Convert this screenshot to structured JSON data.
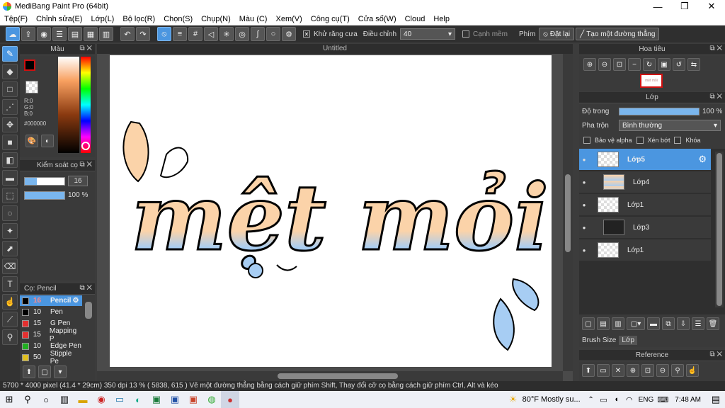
{
  "app": {
    "title": "MediBang Paint Pro (64bit)"
  },
  "window_controls": {
    "minimize": "—",
    "maximize": "❐",
    "close": "✕"
  },
  "menu": [
    "Tệp(F)",
    "Chỉnh sửa(E)",
    "Lớp(L)",
    "Bộ lọc(R)",
    "Chọn(S)",
    "Chụp(N)",
    "Màu (C)",
    "Xem(V)",
    "Công cụ(T)",
    "Cửa sổ(W)",
    "Cloud",
    "Help"
  ],
  "toolbar": {
    "antialias_label": "Khử răng cưa",
    "adjust_label": "Điều chỉnh",
    "adjust_value": "40",
    "sharp_label": "Cạnh mềm",
    "shortcut_label": "Phím",
    "reset_label": "Đặt lại",
    "line_label": "Tạo một đường thẳng"
  },
  "color_panel": {
    "title": "Màu",
    "r": "R:0",
    "g": "G:0",
    "b": "B:0",
    "hex": "#000000",
    "fg_color": "#000000",
    "bg_color": "#ffffff",
    "accent_color": "#d01010"
  },
  "brush_control": {
    "title": "Kiểm soát cọ",
    "size": "16",
    "opacity": "100 %"
  },
  "brush_list": {
    "title": "Cọ: Pencil",
    "items": [
      {
        "size": "16",
        "name": "Pencil",
        "color": "#000000"
      },
      {
        "size": "10",
        "name": "Pen",
        "color": "#000000"
      },
      {
        "size": "15",
        "name": "G Pen",
        "color": "#e53030"
      },
      {
        "size": "15",
        "name": "Mapping P",
        "color": "#e53030"
      },
      {
        "size": "10",
        "name": "Edge Pen",
        "color": "#20b020"
      },
      {
        "size": "50",
        "name": "Stipple Pe",
        "color": "#e0c020"
      }
    ]
  },
  "document": {
    "tab": "Untitled",
    "text_main": "mệt mỏi",
    "peach": "#fbd3a9",
    "blue": "#a7cdf3"
  },
  "navigator": {
    "title": "Hoa tiêu",
    "thumb_text": "mệt mỏi"
  },
  "layers": {
    "title": "Lớp",
    "opacity_label": "Độ trong",
    "opacity_value": "100 %",
    "opacity_fraction": 1.0,
    "blend_label": "Pha trộn",
    "blend_value": "Bình thường",
    "protect_alpha": "Bảo vệ alpha",
    "clipping": "Xén bớt",
    "lock": "Khóa",
    "items": [
      {
        "name": "Lớp5",
        "selected": true
      },
      {
        "name": "Lớp4",
        "selected": false
      },
      {
        "name": "Lớp1",
        "selected": false
      },
      {
        "name": "Lớp3",
        "selected": false
      },
      {
        "name": "Lớp1",
        "selected": false
      }
    ],
    "tab_brush_size": "Brush Size",
    "tab_layer": "Lớp"
  },
  "reference": {
    "title": "Reference"
  },
  "status": "5700 * 4000 pixel  (41.4 * 29cm)   350 dpi   13 %   ( 5838, 615 )   Vẽ một đường thẳng bằng cách giữ phím Shift, Thay đổi cỡ cọ bằng cách giữ phím Ctrl, Alt và kéo",
  "taskbar": {
    "weather": "80°F  Mostly su...",
    "lang": "ENG",
    "time": "7:48 AM"
  }
}
